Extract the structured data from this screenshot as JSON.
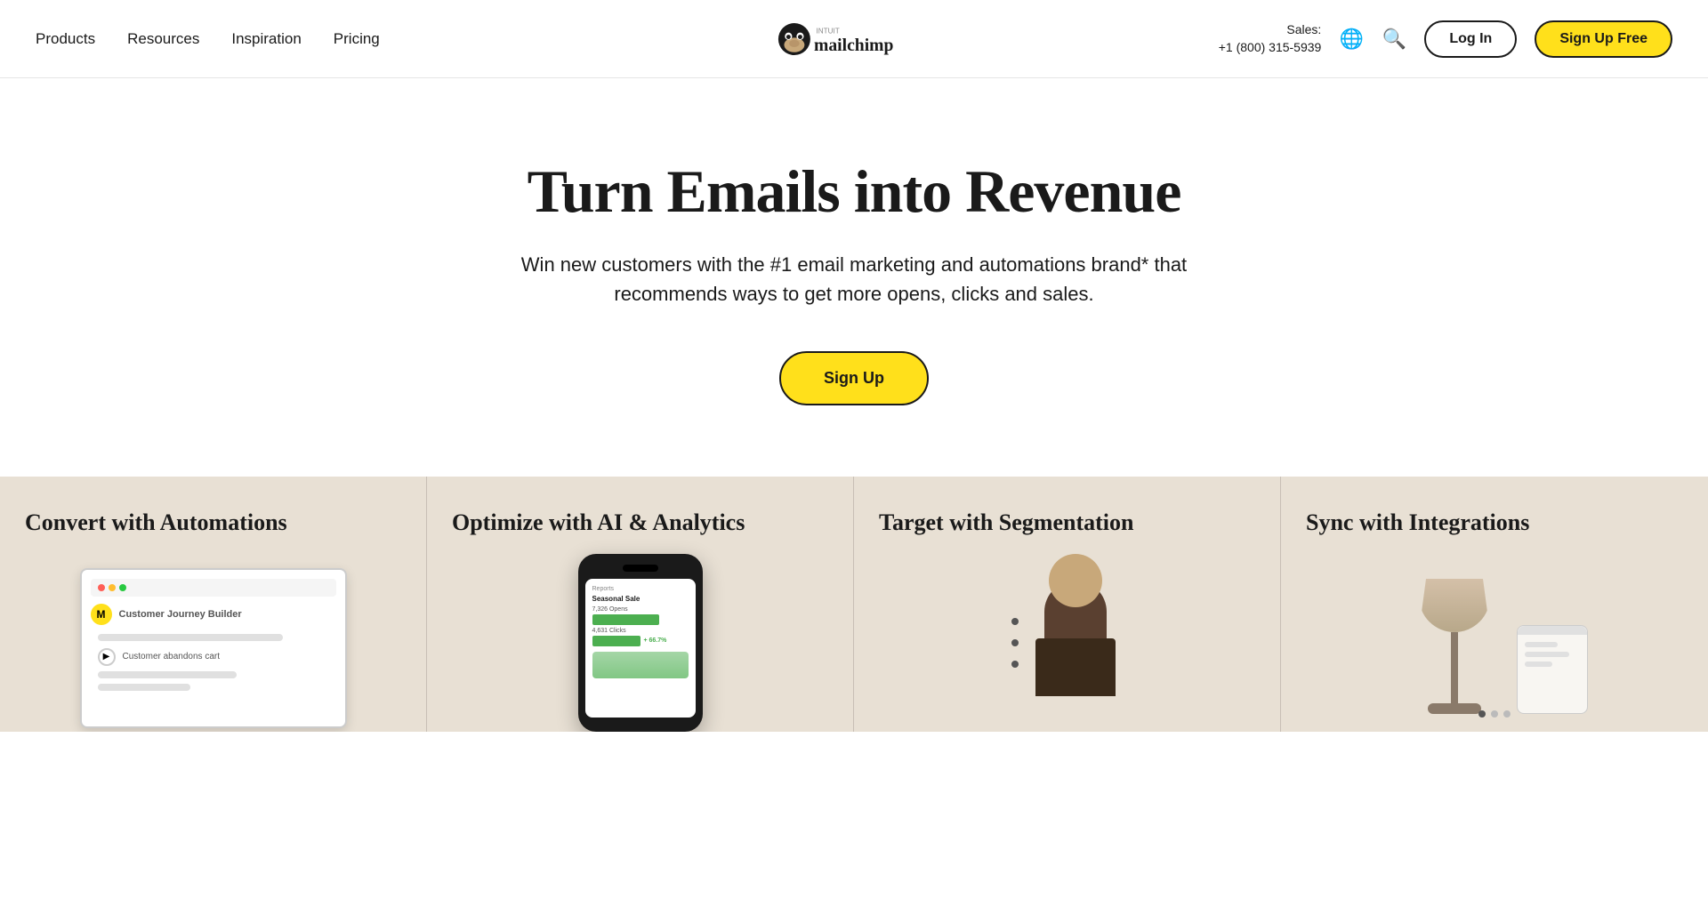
{
  "nav": {
    "items": [
      {
        "label": "Products",
        "id": "products"
      },
      {
        "label": "Resources",
        "id": "resources"
      },
      {
        "label": "Inspiration",
        "id": "inspiration"
      },
      {
        "label": "Pricing",
        "id": "pricing"
      }
    ],
    "logo_alt": "Mailchimp by Intuit",
    "sales_label": "Sales:",
    "sales_phone": "+1 (800) 315-5939",
    "login_label": "Log In",
    "signup_label": "Sign Up Free"
  },
  "hero": {
    "title": "Turn Emails into Revenue",
    "subtitle": "Win new customers with the #1 email marketing and automations brand* that recommends ways to get more opens, clicks and sales.",
    "cta_label": "Sign Up"
  },
  "features": [
    {
      "id": "automations",
      "title": "Convert with Automations",
      "mock_label": "Customer Journey Builder",
      "mock_sublabel": "Customer abandons cart"
    },
    {
      "id": "ai-analytics",
      "title": "Optimize with AI & Analytics",
      "mock_header": "Seasonal Sale",
      "mock_opens": "7,326 Opens",
      "mock_clicks": "4,631 Clicks",
      "mock_pct": "+ 66.7%"
    },
    {
      "id": "segmentation",
      "title": "Target with Segmentation"
    },
    {
      "id": "integrations",
      "title": "Sync with Integrations"
    }
  ],
  "icons": {
    "globe": "🌐",
    "search": "🔍"
  }
}
